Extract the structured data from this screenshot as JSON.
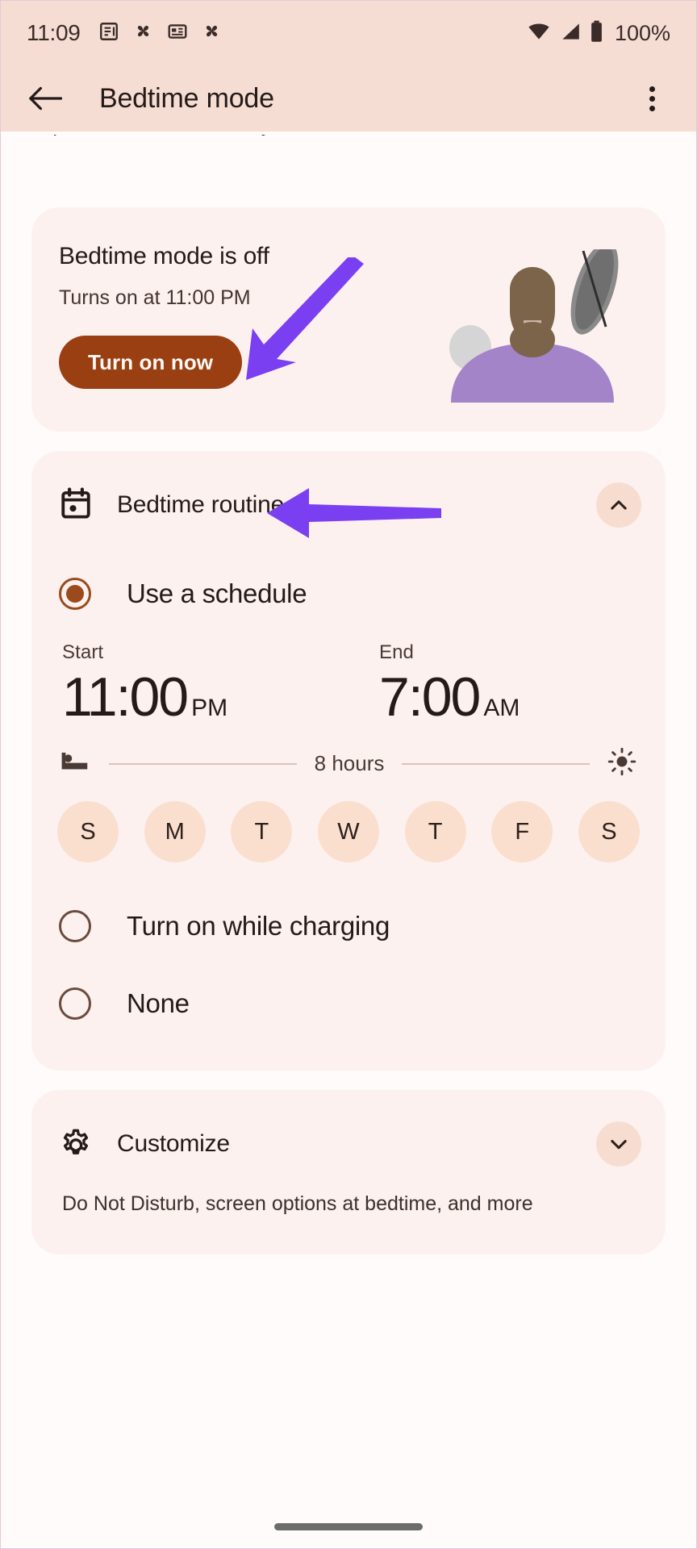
{
  "statusbar": {
    "time": "11:09",
    "battery_percent": "100%",
    "left_icons": [
      "news-article-icon",
      "pinwheel-icon",
      "news-feed-icon",
      "pinwheel-icon"
    ],
    "right_icons": [
      "wifi-icon",
      "cellular-signal-icon",
      "battery-icon"
    ]
  },
  "appbar": {
    "back_icon": "back-arrow-icon",
    "title": "Bedtime mode",
    "overflow_icon": "overflow-menu-icon"
  },
  "intro": {
    "text": "important calls can reach you."
  },
  "status_card": {
    "heading": "Bedtime mode is off",
    "subtext": "Turns on at 11:00 PM",
    "button_label": "Turn on now",
    "button_color": "#9a3f11",
    "illustration": "person-sleeping-illustration"
  },
  "routine": {
    "icon": "calendar-icon",
    "title": "Bedtime routine",
    "collapse_icon": "chevron-up-icon",
    "options": [
      {
        "label": "Use a schedule",
        "selected": true
      },
      {
        "label": "Turn on while charging",
        "selected": false
      },
      {
        "label": "None",
        "selected": false
      }
    ],
    "schedule": {
      "start_label": "Start",
      "start_time": "11:00",
      "start_meridiem": "PM",
      "end_label": "End",
      "end_time": "7:00",
      "end_meridiem": "AM",
      "bed_icon": "bed-icon",
      "duration": "8 hours",
      "sun_icon": "sun-icon",
      "days": [
        {
          "letter": "S",
          "name": "sunday",
          "selected": false
        },
        {
          "letter": "M",
          "name": "monday",
          "selected": false
        },
        {
          "letter": "T",
          "name": "tuesday",
          "selected": false
        },
        {
          "letter": "W",
          "name": "wednesday",
          "selected": false
        },
        {
          "letter": "T",
          "name": "thursday",
          "selected": false
        },
        {
          "letter": "F",
          "name": "friday",
          "selected": false
        },
        {
          "letter": "S",
          "name": "saturday",
          "selected": false
        }
      ]
    }
  },
  "customize": {
    "icon": "gear-icon",
    "title": "Customize",
    "expand_icon": "chevron-down-icon",
    "description": "Do Not Disturb, screen options at bedtime, and more"
  },
  "annotations": {
    "color": "#7b3ff2",
    "arrows": [
      {
        "name": "arrow-to-turn-on-now-button",
        "target": "Turn on now"
      },
      {
        "name": "arrow-to-bedtime-routine-row",
        "target": "Bedtime routine"
      }
    ]
  }
}
